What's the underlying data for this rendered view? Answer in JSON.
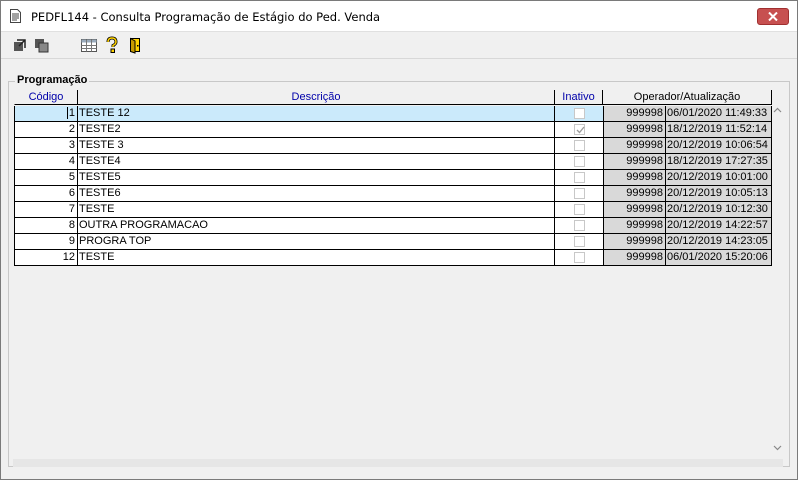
{
  "window": {
    "title": "PEDFL144 - Consulta Programação de Estágio do Ped. Venda"
  },
  "toolbar": {
    "buttons": [
      {
        "icon": "export-icon"
      },
      {
        "icon": "copy-icon"
      },
      {
        "icon": "table-icon"
      },
      {
        "icon": "help-icon"
      },
      {
        "icon": "exit-door-icon"
      }
    ]
  },
  "group": {
    "label": "Programação"
  },
  "grid": {
    "headers": {
      "codigo": "Código",
      "descricao": "Descrição",
      "inativo": "Inativo",
      "operador": "Operador/Atualização"
    },
    "rows": [
      {
        "codigo": "1",
        "descricao": "TESTE 12",
        "inativo": false,
        "operador": "999998",
        "atualizacao": "06/01/2020 11:49:33",
        "selected": true
      },
      {
        "codigo": "2",
        "descricao": "TESTE2",
        "inativo": true,
        "operador": "999998",
        "atualizacao": "18/12/2019 11:52:14"
      },
      {
        "codigo": "3",
        "descricao": "TESTE 3",
        "inativo": false,
        "operador": "999998",
        "atualizacao": "20/12/2019 10:06:54"
      },
      {
        "codigo": "4",
        "descricao": "TESTE4",
        "inativo": false,
        "operador": "999998",
        "atualizacao": "18/12/2019 17:27:35"
      },
      {
        "codigo": "5",
        "descricao": "TESTE5",
        "inativo": false,
        "operador": "999998",
        "atualizacao": "20/12/2019 10:01:00"
      },
      {
        "codigo": "6",
        "descricao": "TESTE6",
        "inativo": false,
        "operador": "999998",
        "atualizacao": "20/12/2019 10:05:13"
      },
      {
        "codigo": "7",
        "descricao": "TESTE",
        "inativo": false,
        "operador": "999998",
        "atualizacao": "20/12/2019 10:12:30"
      },
      {
        "codigo": "8",
        "descricao": "OUTRA PROGRAMACAO",
        "inativo": false,
        "operador": "999998",
        "atualizacao": "20/12/2019 14:22:57"
      },
      {
        "codigo": "9",
        "descricao": "PROGRA TOP",
        "inativo": false,
        "operador": "999998",
        "atualizacao": "20/12/2019 14:23:05"
      },
      {
        "codigo": "12",
        "descricao": "TESTE",
        "inativo": false,
        "operador": "999998",
        "atualizacao": "06/01/2020 15:20:06"
      }
    ]
  },
  "colors": {
    "selected_row": "#cbeafb",
    "header_text": "#0000aa",
    "readonly_cell": "#d9d9d9",
    "close_button": "#c75050"
  }
}
